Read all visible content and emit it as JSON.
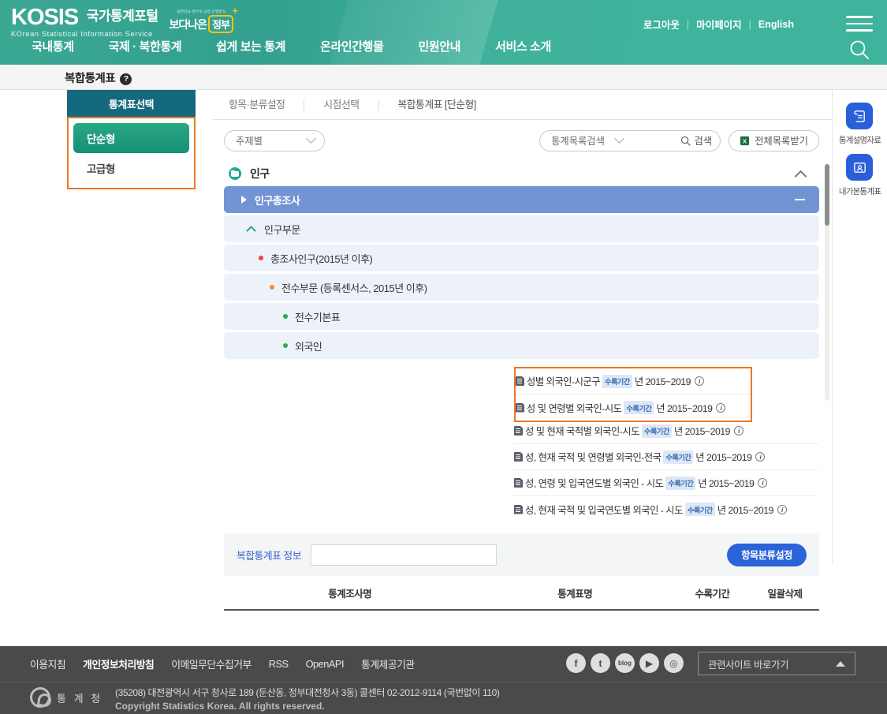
{
  "header": {
    "logo": {
      "kosis": "KOSIS",
      "korean": "국가통계포털",
      "subtitle": "KOrean Statistical Information Service",
      "badge_top": "대한민국 정부의 국정 운영방식",
      "badge_main": "보다나은",
      "badge_chip": "정부"
    },
    "util": {
      "logout": "로그아웃",
      "mypage": "마이페이지",
      "english": "English"
    },
    "gnb": [
      "국내통계",
      "국제 · 북한통계",
      "쉽게 보는 통계",
      "온라인간행물",
      "민원안내",
      "서비스 소개"
    ]
  },
  "subbar": {
    "title": "복합통계표",
    "help": "?"
  },
  "left_panel": {
    "head": "통계표선택",
    "items": [
      {
        "label": "단순형",
        "active": true
      },
      {
        "label": "고급형",
        "active": false
      }
    ]
  },
  "main": {
    "tabs": [
      {
        "label": "항목·분류설정"
      },
      {
        "label": "시점선택"
      },
      {
        "label": "복합통계표 [단순형]"
      }
    ],
    "controls": {
      "category_select": "주제별",
      "search_select": "통계목록검색",
      "search_button": "검색",
      "download_button": "전체목록받기"
    },
    "tree": {
      "root": "인구",
      "nodes": [
        {
          "label": "인구총조사",
          "level": 1,
          "selected": true
        },
        {
          "label": "인구부문",
          "level": 2,
          "selected": false
        },
        {
          "label": "총조사인구(2015년 이후)",
          "level": 3,
          "selected": false
        },
        {
          "label": "전수부문 (등록센서스, 2015년 이후)",
          "level": 4,
          "selected": false
        },
        {
          "label": "전수기본표",
          "level": 5,
          "selected": false
        },
        {
          "label": "외국인",
          "level": 5,
          "selected": false
        }
      ],
      "tables_highlighted": [
        {
          "name": "성별 외국인-시군구",
          "tag": "수록기간",
          "period": "년 2015~2019"
        },
        {
          "name": "성 및 연령별 외국인-시도",
          "tag": "수록기간",
          "period": "년 2015~2019"
        }
      ],
      "tables": [
        {
          "name": "성 및 현재 국적별 외국인-시도",
          "tag": "수록기간",
          "period": "년 2015~2019"
        },
        {
          "name": "성, 현재 국적 및 연령별 외국인-전국",
          "tag": "수록기간",
          "period": "년 2015~2019"
        },
        {
          "name": "성, 연령 및 입국연도별 외국인 - 시도",
          "tag": "수록기간",
          "period": "년 2015~2019"
        },
        {
          "name": "성, 현재 국적 및 입국연도별 외국인 - 시도",
          "tag": "수록기간",
          "period": "년 2015~2019"
        }
      ]
    },
    "info_panel": {
      "label": "복합통계표 정보",
      "input_value": "",
      "input_placeholder": "",
      "button": "항목분류설정"
    },
    "table_header": [
      "통계조사명",
      "통계표명",
      "수록기간",
      "일괄삭제"
    ]
  },
  "rail": [
    {
      "label": "통계설명자료",
      "icon": "scroll-document-icon"
    },
    {
      "label": "내가본통계표",
      "icon": "bookmark-board-icon"
    }
  ],
  "footer": {
    "links": [
      {
        "label": "이용지침",
        "strong": false
      },
      {
        "label": "개인정보처리방침",
        "strong": true
      },
      {
        "label": "이메일무단수집거부",
        "strong": false
      },
      {
        "label": "RSS",
        "strong": false
      },
      {
        "label": "OpenAPI",
        "strong": false
      },
      {
        "label": "통계제공기관",
        "strong": false
      }
    ],
    "social": [
      "f",
      "t",
      "blog",
      "▶",
      "◎"
    ],
    "select": "관련사이트 바로가기",
    "emblem": "통 계 청",
    "address": "(35208) 대전광역시 서구 청사로 189 (둔산동, 정부대전청사 3동) 콜센터 02-2012-9114 (국번없이 110)",
    "copyright": "Copyright Statistics Korea. All rights reserved."
  },
  "colors": {
    "header_green": "#3aa893",
    "panel_head_teal": "#14697f",
    "active_green": "#1e9c83",
    "highlight_orange": "#ee7722",
    "selected_blue": "#7394d4",
    "row_bg": "#edf2fa",
    "button_blue": "#2b63d9",
    "footer_gray": "#4a4a4a"
  }
}
